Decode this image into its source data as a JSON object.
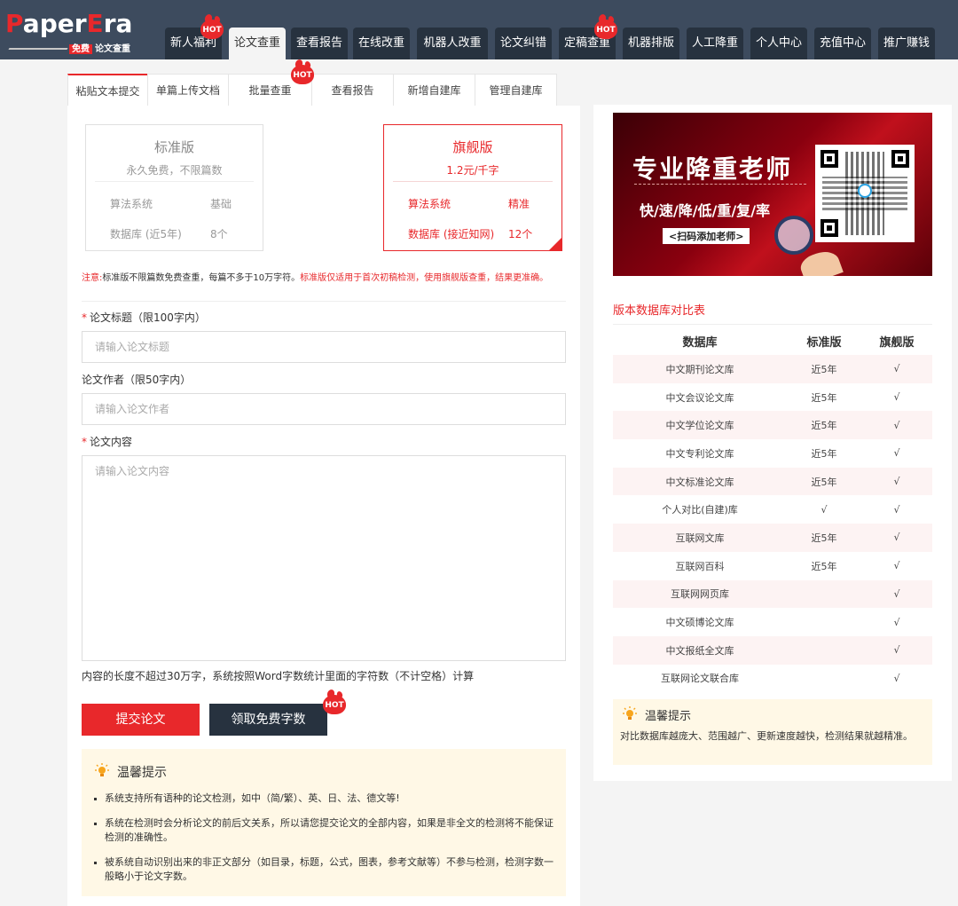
{
  "brand": {
    "logo_text": "PaperEra",
    "free_label": "免费",
    "sub_label": "论文查重"
  },
  "nav": {
    "items": [
      {
        "label": "新人福利",
        "hot": true
      },
      {
        "label": "论文查重",
        "active": true
      },
      {
        "label": "查看报告"
      },
      {
        "label": "在线改重"
      },
      {
        "label": "机器人改重"
      },
      {
        "label": "论文纠错"
      },
      {
        "label": "定稿查重",
        "hot": true
      },
      {
        "label": "机器排版"
      },
      {
        "label": "人工降重"
      },
      {
        "label": "个人中心"
      },
      {
        "label": "充值中心"
      },
      {
        "label": "推广赚钱"
      }
    ],
    "hot_label": "HOT"
  },
  "tabs": [
    {
      "label": "粘贴文本提交",
      "active": true
    },
    {
      "label": "单篇上传文档"
    },
    {
      "label": "批量查重",
      "hot": true
    },
    {
      "label": "查看报告"
    },
    {
      "label": "新增自建库"
    },
    {
      "label": "管理自建库"
    }
  ],
  "versions": {
    "standard": {
      "title": "标准版",
      "price": "永久免费，不限篇数",
      "algo_key": "算法系统",
      "algo_val": "基础",
      "db_key": "数据库 (近5年)",
      "db_val": "8个"
    },
    "pro": {
      "title": "旗舰版",
      "price": "1.2元/千字",
      "algo_key": "算法系统",
      "algo_val": "精准",
      "db_key": "数据库 (接近知网)",
      "db_val": "12个"
    }
  },
  "notice": {
    "prefix": "注意:",
    "text": "标准版不限篇数免费查重，每篇不多于10万字符。",
    "red_text": "标准版仅适用于首次初稿检测，使用旗舰版查重，结果更准确。"
  },
  "form": {
    "title_label": "论文标题（限100字内）",
    "title_placeholder": "请输入论文标题",
    "author_label": "论文作者（限50字内）",
    "author_placeholder": "请输入论文作者",
    "content_label": "论文内容",
    "content_placeholder": "请输入论文内容",
    "required_mark": "*",
    "hint": "内容的长度不超过30万字，系统按照Word字数统计里面的字符数（不计空格）计算"
  },
  "buttons": {
    "submit": "提交论文",
    "free_words": "领取免费字数"
  },
  "tips": {
    "title": "温馨提示",
    "items": [
      "系统支持所有语种的论文检测，如中（简/繁）、英、日、法、德文等!",
      "系统在检测时会分析论文的前后文关系，所以请您提交论文的全部内容，如果是非全文的检测将不能保证检测的准确性。",
      "被系统自动识别出来的非正文部分（如目录，标题，公式，图表，参考文献等）不参与检测，检测字数一般略小于论文字数。"
    ]
  },
  "banner": {
    "title": "专业降重老师",
    "subtitle": "快/速/降/低/重/复/率",
    "tag": "<扫码添加老师>"
  },
  "compare": {
    "title": "版本数据库对比表",
    "headers": [
      "数据库",
      "标准版",
      "旗舰版"
    ],
    "rows": [
      [
        "中文期刊论文库",
        "近5年",
        "√"
      ],
      [
        "中文会议论文库",
        "近5年",
        "√"
      ],
      [
        "中文学位论文库",
        "近5年",
        "√"
      ],
      [
        "中文专利论文库",
        "近5年",
        "√"
      ],
      [
        "中文标准论文库",
        "近5年",
        "√"
      ],
      [
        "个人对比(自建)库",
        "√",
        "√"
      ],
      [
        "互联网文库",
        "近5年",
        "√"
      ],
      [
        "互联网百科",
        "近5年",
        "√"
      ],
      [
        "互联网网页库",
        "",
        "√"
      ],
      [
        "中文硕博论文库",
        "",
        "√"
      ],
      [
        "中文报纸全文库",
        "",
        "√"
      ],
      [
        "互联网论文联合库",
        "",
        "√"
      ]
    ]
  },
  "right_tip": {
    "title": "温馨提示",
    "text": "对比数据库越庞大、范围越广、更新速度越快，检测结果就越精准。"
  },
  "colors": {
    "nav_bg": "#3d4b5e",
    "nav_item": "#27323f",
    "accent": "#e8282b",
    "tip_bg": "#fff8e6"
  }
}
